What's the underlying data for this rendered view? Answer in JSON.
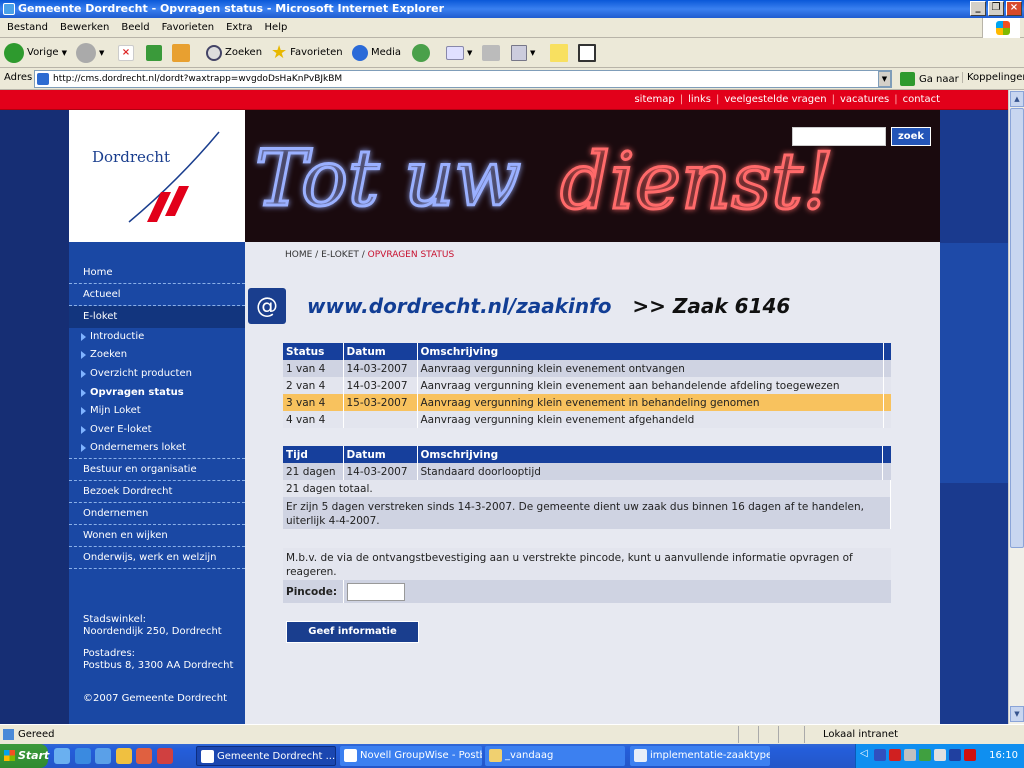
{
  "window": {
    "title": "Gemeente Dordrecht - Opvragen status - Microsoft Internet Explorer"
  },
  "menu": [
    "Bestand",
    "Bewerken",
    "Beeld",
    "Favorieten",
    "Extra",
    "Help"
  ],
  "toolbar": {
    "back": "Vorige",
    "search": "Zoeken",
    "favorites": "Favorieten",
    "media": "Media"
  },
  "address": {
    "label": "Adres",
    "url": "http://cms.dordrecht.nl/dordt?waxtrapp=wvgdoDsHaKnPvBJkBM",
    "go": "Ga naar",
    "links": "Koppelingen"
  },
  "site": {
    "top_links": [
      "sitemap",
      "links",
      "veelgestelde vragen",
      "vacatures",
      "contact"
    ],
    "logo_name": "Dordrecht",
    "banner_text": "Tot uw dienst!",
    "search_button": "zoek",
    "nav": {
      "items": [
        "Home",
        "Actueel",
        "E-loket"
      ],
      "sub": [
        "Introductie",
        "Zoeken",
        "Overzicht producten",
        "Opvragen status",
        "Mijn Loket",
        "Over E-loket",
        "Ondernemers loket"
      ],
      "items2": [
        "Bestuur en organisatie",
        "Bezoek Dordrecht",
        "Ondernemen",
        "Wonen en wijken",
        "Onderwijs, werk en welzijn"
      ],
      "stadswinkel_label": "Stadswinkel:",
      "stadswinkel_addr": "Noordendijk 250, Dordrecht",
      "postadres_label": "Postadres:",
      "postadres_addr": "Postbus 8, 3300 AA Dordrecht",
      "copyright": "©2007 Gemeente Dordrecht"
    },
    "breadcrumb": {
      "home": "HOME",
      "eloket": "E-LOKET",
      "current": "OPVRAGEN STATUS"
    },
    "heading_url": "www.dordrecht.nl/zaakinfo",
    "heading_case": ">> Zaak 6146",
    "status_table": {
      "headers": [
        "Status",
        "Datum",
        "Omschrijving"
      ],
      "rows": [
        [
          "1 van 4",
          "14-03-2007",
          "Aanvraag vergunning klein evenement ontvangen"
        ],
        [
          "2 van 4",
          "14-03-2007",
          "Aanvraag vergunning klein evenement aan behandelende afdeling toegewezen"
        ],
        [
          "3 van 4",
          "15-03-2007",
          "Aanvraag vergunning klein evenement in behandeling genomen"
        ],
        [
          "4 van 4",
          "",
          "Aanvraag vergunning klein evenement afgehandeld"
        ]
      ]
    },
    "time_table": {
      "headers": [
        "Tijd",
        "Datum",
        "Omschrijving"
      ],
      "row": [
        "21 dagen",
        "14-03-2007",
        "Standaard doorlooptijd"
      ],
      "total": "21 dagen totaal.",
      "note": "Er zijn 5 dagen verstreken sinds 14-3-2007. De gemeente dient uw zaak dus binnen 16 dagen af te handelen, uiterlijk 4-4-2007."
    },
    "pincode_info": "M.b.v. de via de ontvangstbevestiging aan u verstrekte pincode, kunt u aanvullende informatie opvragen of reageren.",
    "pincode_label": "Pincode:",
    "submit": "Geef informatie"
  },
  "status": {
    "text": "Gereed",
    "zone": "Lokaal intranet"
  },
  "taskbar": {
    "start": "Start",
    "tasks": [
      "Gemeente Dordrecht ...",
      "Novell GroupWise - Postbus",
      "_vandaag",
      "implementatie-zaaktype-..."
    ],
    "clock": "16:10"
  }
}
